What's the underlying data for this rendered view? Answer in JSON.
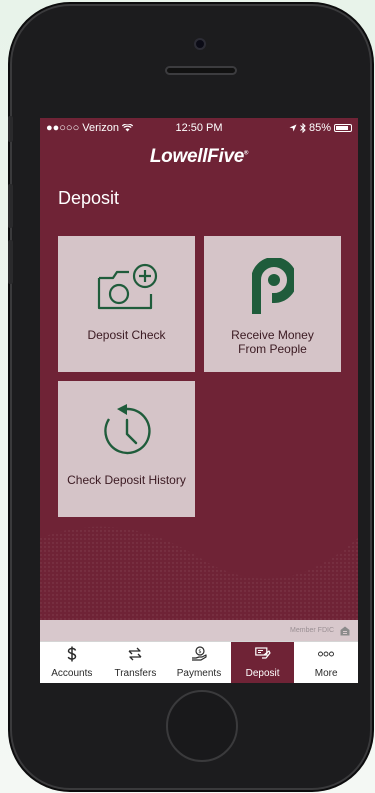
{
  "status_bar": {
    "carrier": "●●○○○ Verizon",
    "time": "12:50 PM",
    "battery": "85%",
    "battery_level": 0.85
  },
  "brand": {
    "logo_text": "LowellFive"
  },
  "page": {
    "title": "Deposit"
  },
  "tiles": [
    {
      "label": "Deposit Check",
      "icon": "camera-plus-icon"
    },
    {
      "label": "Receive Money From People",
      "icon": "p-logo-icon"
    },
    {
      "label": "Check Deposit History",
      "icon": "history-clock-icon"
    }
  ],
  "footer": {
    "fdic_text": "Member FDIC"
  },
  "tabbar": {
    "items": [
      {
        "label": "Accounts",
        "icon": "dollar-icon"
      },
      {
        "label": "Transfers",
        "icon": "transfer-arrows-icon"
      },
      {
        "label": "Payments",
        "icon": "payments-icon"
      },
      {
        "label": "Deposit",
        "icon": "deposit-check-icon",
        "active": true
      },
      {
        "label": "More",
        "icon": "more-dots-icon"
      }
    ]
  },
  "colors": {
    "brand_maroon": "#6f2336",
    "tile_bg": "#d5c4c8",
    "icon_green": "#1f5c3b"
  }
}
